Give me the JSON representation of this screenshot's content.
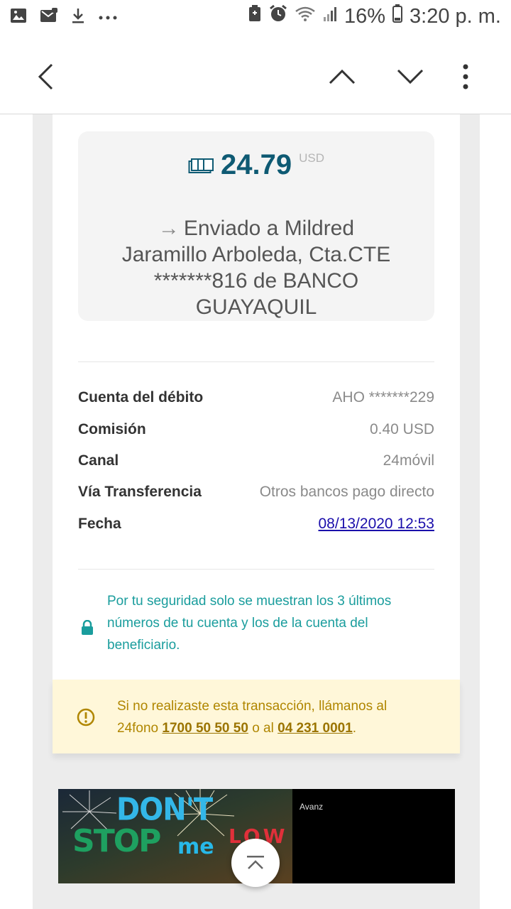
{
  "status_bar": {
    "battery_percent": "16%",
    "time": "3:20 p. m."
  },
  "app_bar": {
    "back_icon": "chevron-left-icon",
    "prev_icon": "chevron-up-icon",
    "next_icon": "chevron-down-icon",
    "menu_icon": "more-vertical-icon"
  },
  "transaction": {
    "amount": "24.79",
    "currency": "USD",
    "sent_to_line1": "Enviado a Mildred",
    "sent_to_line2": "Jaramillo Arboleda, Cta.CTE",
    "sent_to_line3": "*******816 de BANCO",
    "sent_to_line4": "GUAYAQUIL",
    "amount_color": "#0e5a73"
  },
  "details": {
    "debit_label": "Cuenta del débito",
    "debit_value": "AHO *******229",
    "commission_label": "Comisión",
    "commission_value": "0.40 USD",
    "channel_label": "Canal",
    "channel_value": "24móvil",
    "transfer_label": "Vía Transferencia",
    "transfer_value": "Otros bancos pago directo",
    "date_label": "Fecha",
    "date_value": "08/13/2020 12:53"
  },
  "security_note": {
    "line1": "Por tu seguridad solo se muestran los 3 últimos",
    "line2": "números de tu cuenta y los de la cuenta del",
    "line3": "beneficiario.",
    "color": "#1a9d9d"
  },
  "warning": {
    "line1": "Si no realizaste esta transacción, llámanos al",
    "prefix2": "24fono",
    "phone1": "1700 50 50 50",
    "middle": "o al",
    "phone2": "04 231 0001",
    "suffix": ".",
    "color": "#b08600",
    "background": "#fff7d9"
  },
  "banner": {
    "word1": "DON'T",
    "word2": "STOP",
    "word3": "me",
    "word4": "LOW",
    "ad_text": "Avanz"
  }
}
